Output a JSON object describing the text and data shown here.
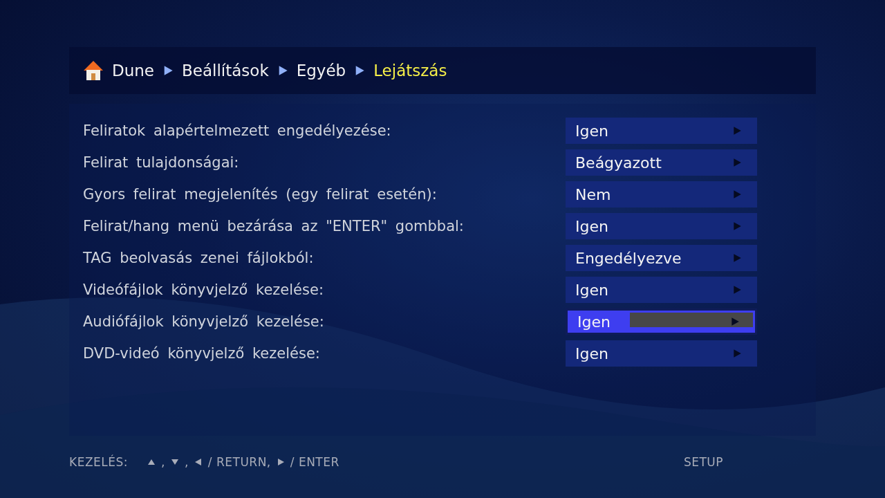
{
  "breadcrumb": [
    {
      "label": "Dune",
      "current": false
    },
    {
      "label": "Beállítások",
      "current": false
    },
    {
      "label": "Egyéb",
      "current": false
    },
    {
      "label": "Lejátszás",
      "current": true
    }
  ],
  "settings": [
    {
      "label": "Feliratok alapértelmezett engedélyezése:",
      "value": "Igen",
      "selected": false
    },
    {
      "label": "Felirat tulajdonságai:",
      "value": "Beágyazott",
      "selected": false
    },
    {
      "label": "Gyors felirat megjelenítés (egy felirat esetén):",
      "value": "Nem",
      "selected": false
    },
    {
      "label": "Felirat/hang menü bezárása az \"ENTER\" gombbal:",
      "value": "Igen",
      "selected": false
    },
    {
      "label": "TAG beolvasás zenei fájlokból:",
      "value": "Engedélyezve",
      "selected": false
    },
    {
      "label": "Videófájlok könyvjelző kezelése:",
      "value": "Igen",
      "selected": false
    },
    {
      "label": "Audiófájlok könyvjelző kezelése:",
      "value": "Igen",
      "selected": true
    },
    {
      "label": "DVD-videó könyvjelző kezelése:",
      "value": "Igen",
      "selected": false
    }
  ],
  "footer": {
    "title": "KEZELÉS:",
    "keys": [
      {
        "kind": "up",
        "text": ","
      },
      {
        "kind": "down",
        "text": ","
      },
      {
        "kind": "left",
        "text": "/ RETURN,"
      },
      {
        "kind": "right",
        "text": "/ ENTER"
      }
    ],
    "mode": "SETUP"
  }
}
